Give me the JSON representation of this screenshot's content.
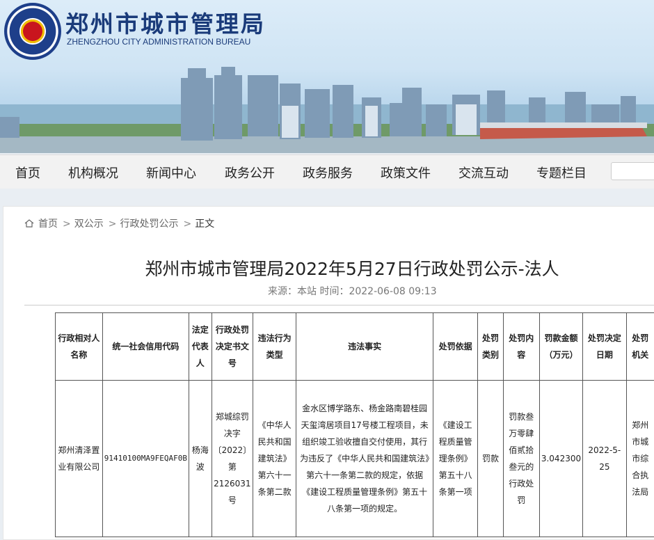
{
  "site": {
    "name_cn": "郑州市城市管理局",
    "name_en": "ZHENGZHOU CITY ADMINISTRATION BUREAU"
  },
  "nav": {
    "items": [
      "首页",
      "机构概况",
      "新闻中心",
      "政务公开",
      "政务服务",
      "政策文件",
      "交流互动",
      "专题栏目"
    ]
  },
  "breadcrumb": [
    "首页",
    "双公示",
    "行政处罚公示",
    "正文"
  ],
  "article": {
    "title": "郑州市城市管理局2022年5月27日行政处罚公示-法人",
    "meta": "来源：本站 时间：2022-06-08 09:13"
  },
  "table": {
    "headers": [
      "行政相对人名称",
      "统一社会信用代码",
      "法定代表人",
      "行政处罚决定书文号",
      "违法行为类型",
      "违法事实",
      "处罚依据",
      "处罚类别",
      "处罚内容",
      "罚款金额（万元）",
      "处罚决定日期",
      "处罚机关"
    ],
    "row": [
      "郑州清泽置业有限公司",
      "91410100MA9FEQAF0B",
      "杨海波",
      "郑城综罚决字〔2022〕第2126031号",
      "《中华人民共和国建筑法》第六十一条第二款",
      "金水区博学路东、杨金路南碧桂园天玺湾居项目17号楼工程项目，未组织竣工验收擅自交付使用，其行为违反了《中华人民共和国建筑法》第六十一条第二款的规定，依据《建设工程质量管理条例》第五十八条第一项的规定。",
      "《建设工程质量管理条例》第五十八条第一项",
      "罚款",
      "罚款叁万零肆佰贰拾叁元的行政处罚",
      "3.042300",
      "2022-5-25",
      "郑州市城市综合执法局"
    ]
  }
}
